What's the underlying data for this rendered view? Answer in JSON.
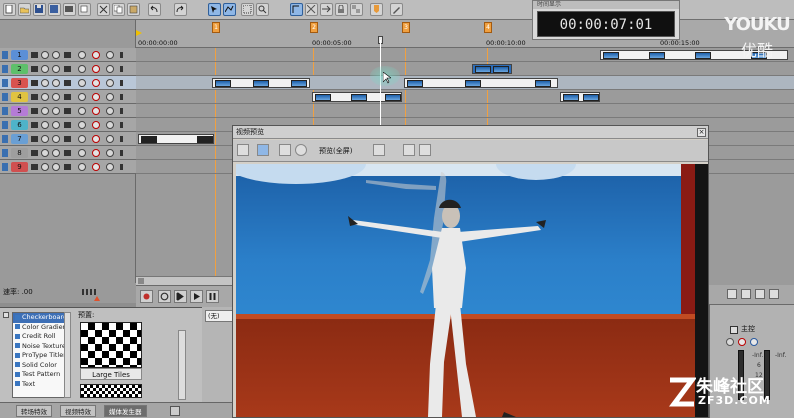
{
  "timecode": {
    "title": "时间显示",
    "value": "00:00:07:01"
  },
  "watermark_top": {
    "brand": "YOUKU",
    "sub": "优酷"
  },
  "watermark_bottom": {
    "brand": "朱峰社区",
    "site": "ZF3D.COM"
  },
  "toolbar": {
    "buttons": [
      "new-icon",
      "open-icon",
      "save-icon",
      "save-as-icon",
      "render-icon",
      "properties-icon",
      "cut-icon",
      "copy-icon",
      "paste-icon",
      "undo-icon",
      "redo-icon",
      "normal-edit-tool-icon",
      "envelope-edit-tool-icon",
      "selection-tool-icon",
      "zoom-tool-icon",
      "snap-icon",
      "auto-crossfade-icon",
      "ripple-edit-icon",
      "lock-envelope-icon",
      "ignore-grouping-icon",
      "marker-icon"
    ]
  },
  "ruler": {
    "times": [
      "00:00:00:00",
      "00:00:05:00",
      "00:00:10:00",
      "00:00:15:00"
    ],
    "markers": [
      "1",
      "2",
      "3",
      "4",
      "5"
    ]
  },
  "tracks": [
    {
      "num": "1",
      "color": "#5b8fd6"
    },
    {
      "num": "2",
      "color": "#5ec06b"
    },
    {
      "num": "3",
      "color": "#d9534f",
      "selected": true
    },
    {
      "num": "4",
      "color": "#e0c341"
    },
    {
      "num": "5",
      "color": "#b57bd6"
    },
    {
      "num": "6",
      "color": "#4fb3c9"
    },
    {
      "num": "7",
      "color": "#6a9fd4"
    },
    {
      "num": "8",
      "color": "#9e9e9e"
    },
    {
      "num": "9",
      "color": "#d05050"
    }
  ],
  "rate": {
    "label": "速率: .00"
  },
  "generators": {
    "items": [
      "Checkerboard",
      "Color Gradient",
      "Credit Roll",
      "Noise Texture",
      "ProType Titler",
      "Solid Color",
      "Test Pattern",
      "Text"
    ],
    "selected": "Checkerboard"
  },
  "presets": {
    "label": "预置:",
    "current": "Large Tiles"
  },
  "none_select": "(无)",
  "tabs": [
    "转场特效",
    "视频特效",
    "媒体发生器"
  ],
  "active_tab": "媒体发生器",
  "preview": {
    "title": "视频预览",
    "quality": "预览(全屏)"
  },
  "mixer": {
    "master_label": "主控",
    "level_left": "-Inf.",
    "level_right": "-Inf.",
    "scale_top": "6",
    "scale_mid": "12"
  }
}
